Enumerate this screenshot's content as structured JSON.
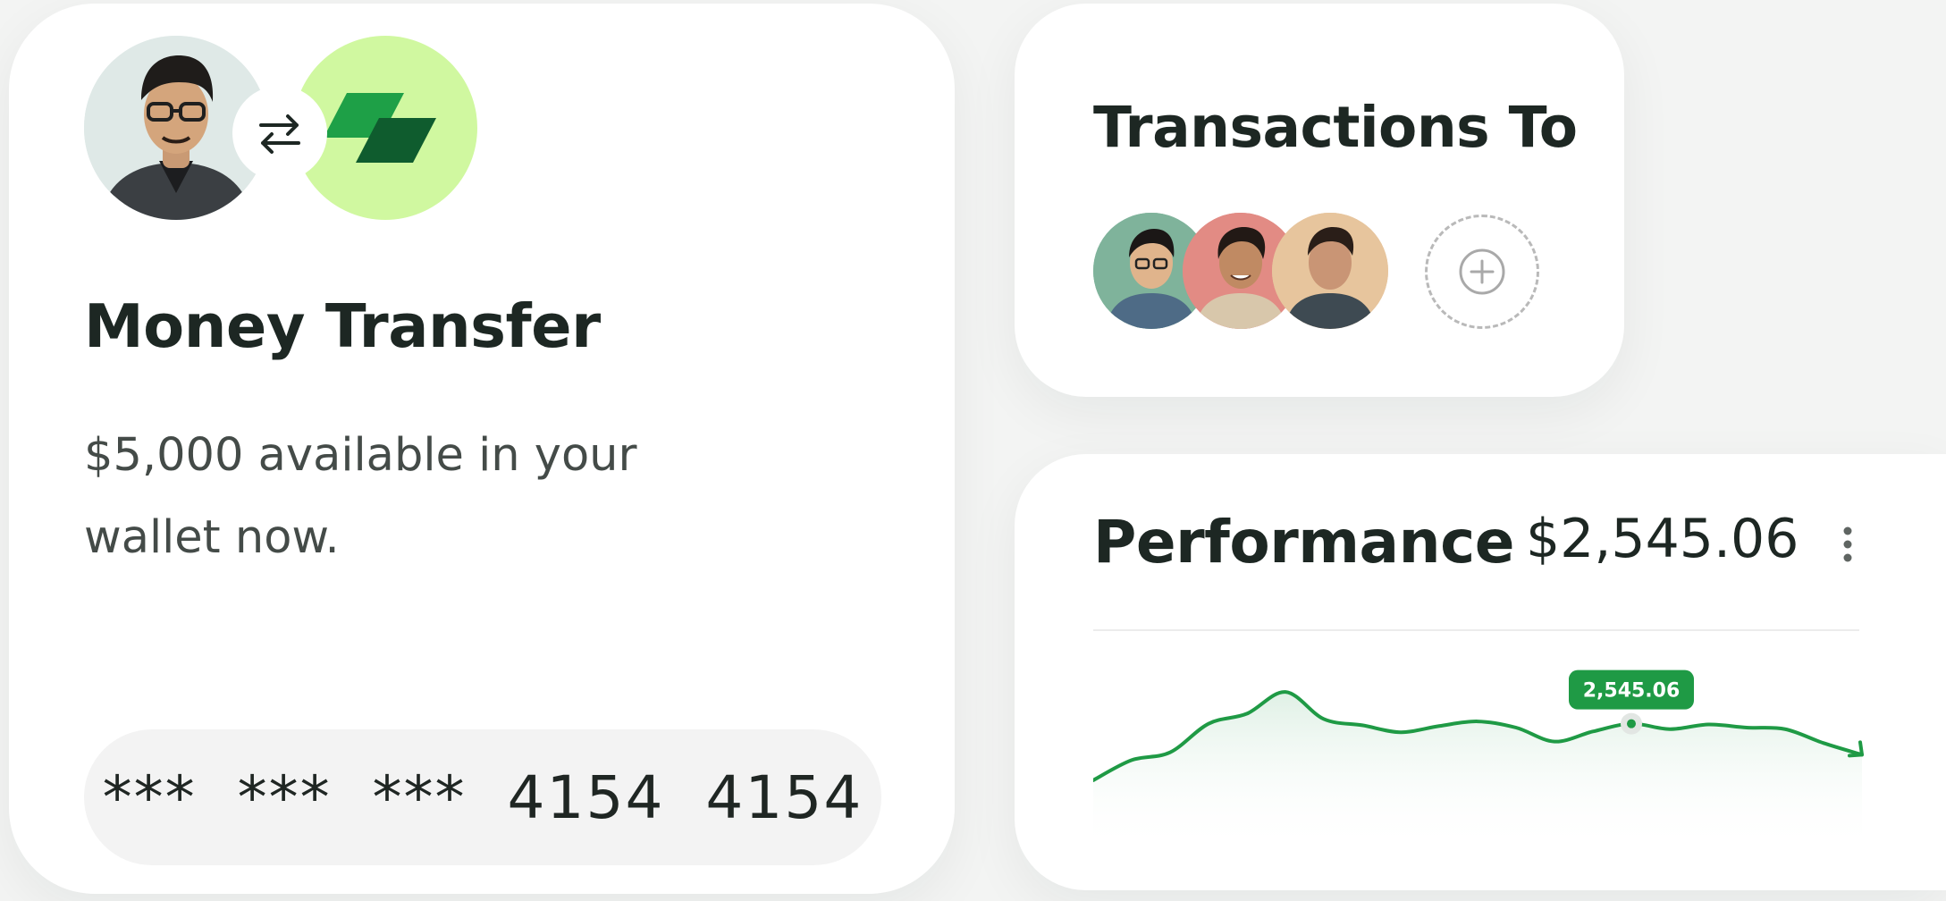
{
  "money_transfer": {
    "title": "Money Transfer",
    "description": "$5,000 available in your wallet now.",
    "card_number": "***  ***  ***  4154  4154"
  },
  "transactions": {
    "title": "Transactions To"
  },
  "performance": {
    "title": "Performance",
    "value": "$2,545.06",
    "tooltip": "2,545.06"
  },
  "chart_data": {
    "type": "area",
    "title": "",
    "xlabel": "",
    "ylabel": "",
    "y": [
      22,
      48,
      58,
      95,
      108,
      136,
      101,
      93,
      84,
      92,
      98,
      90,
      72,
      85,
      95,
      88,
      94,
      90,
      88,
      70,
      55
    ],
    "highlight": {
      "index": 14,
      "label": "2,545.06"
    },
    "ylim": [
      0,
      150
    ],
    "grid": false,
    "color": "#1f9a45",
    "fill_color": "#e8f4ec"
  },
  "colors": {
    "accent_green": "#1f9a45",
    "brand_light": "#d0f8a0",
    "brand_dark_green": "#0f5c2e"
  },
  "icons": {
    "swap": "swap-arrows-icon",
    "brand": "brand-logo-icon",
    "add": "add-contact-icon",
    "more": "more-vertical-icon"
  }
}
